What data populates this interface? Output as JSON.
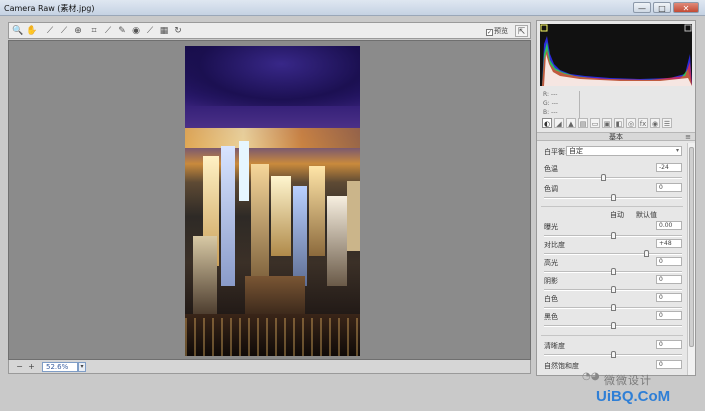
{
  "window": {
    "title": "Camera Raw (素材.jpg)",
    "buttons": [
      "—",
      "□",
      "✕"
    ]
  },
  "toolbar": {
    "preview_label": "预览",
    "preview_checked": true,
    "tools": [
      "zoom-icon",
      "hand-icon",
      "white-balance-icon",
      "color-sampler-icon",
      "target-adjust-icon",
      "crop-icon",
      "straighten-icon",
      "spot-removal-icon",
      "red-eye-icon",
      "brush-icon",
      "graduated-filter-icon",
      "rotate-icon"
    ]
  },
  "status": {
    "zoom_value": "52.6%"
  },
  "rgb": {
    "r": "R:  ---",
    "g": "G:  ---",
    "b": "B:  ---"
  },
  "panel": {
    "section_title": "基本",
    "white_balance_label": "白平衡:",
    "white_balance_value": "自定",
    "temperature_label": "色温",
    "temperature_value": "-24",
    "temperature_level": 0.43,
    "tint_label": "色调",
    "tint_value": "0",
    "tint_level": 0.5,
    "auto_label": "自动",
    "default_label": "默认值",
    "exposure_label": "曝光",
    "exposure_value": "0.00",
    "exposure_level": 0.5,
    "contrast_label": "对比度",
    "contrast_value": "+48",
    "contrast_level": 0.74,
    "highlights_label": "高光",
    "highlights_value": "0",
    "highlights_level": 0.5,
    "shadows_label": "阴影",
    "shadows_value": "0",
    "shadows_level": 0.5,
    "whites_label": "白色",
    "whites_value": "0",
    "whites_level": 0.5,
    "blacks_label": "黑色",
    "blacks_value": "0",
    "blacks_level": 0.5,
    "clarity_label": "清晰度",
    "clarity_value": "0",
    "clarity_level": 0.5,
    "vibrance_label": "自然饱和度",
    "vibrance_value": "0",
    "vibrance_level": 0.5
  },
  "watermark": {
    "line1": "微微设计",
    "line2": "UiBQ.CoM"
  },
  "colors": {
    "accent": "#2f7fd6",
    "panel_bg": "#e7e7e7",
    "canvas_bg": "#8b8b8b"
  }
}
